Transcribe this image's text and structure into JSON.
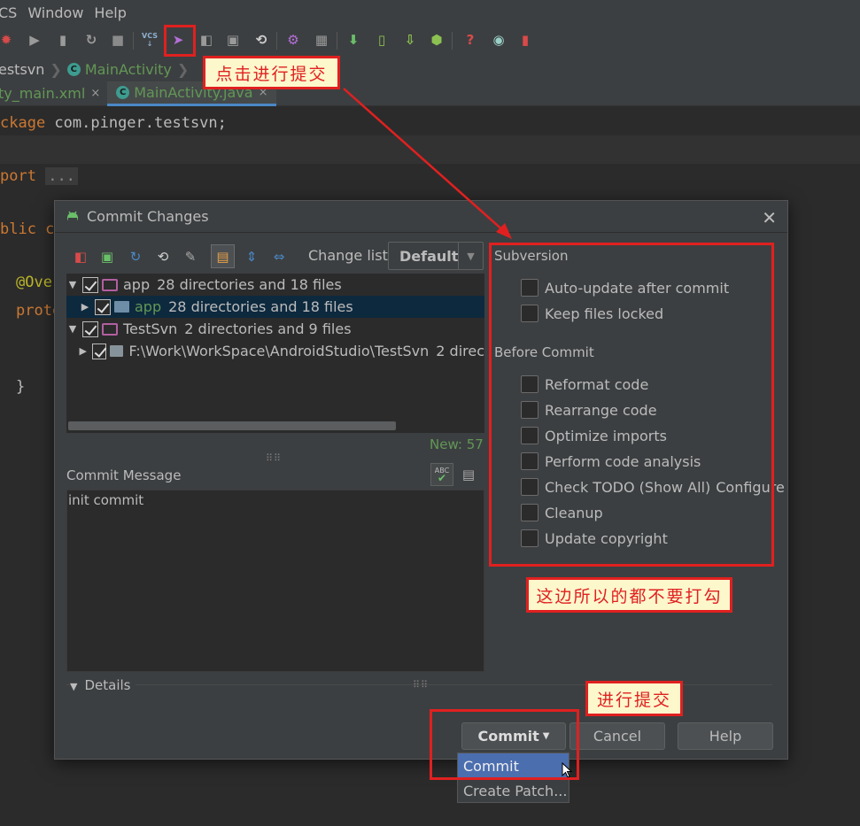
{
  "menubar": {
    "items": [
      "CS",
      "Window",
      "Help"
    ]
  },
  "breadcrumb": {
    "project": "estsvn",
    "class": "MainActivity"
  },
  "tabs": [
    {
      "label": "ty_main.xml",
      "close": "×"
    },
    {
      "label": "MainActivity.java",
      "close": "×"
    }
  ],
  "code": {
    "line1_kw": "ckage",
    "line1_rest": " com.pinger.testsvn;",
    "line2_kw": "port",
    "line2_fold": "...",
    "line3_kw": "blic c",
    "line4": "@Ove",
    "line5": "prote",
    "line6": "}"
  },
  "callouts": {
    "click_commit": "点击进行提交",
    "no_check": "这边所以的都不要打勾",
    "do_commit": "进行提交"
  },
  "dialog": {
    "title": "Commit Changes",
    "close": "✕",
    "changelist_label": "Change list:",
    "changelist_value": "Default",
    "tree": [
      {
        "name": "app",
        "info": "28 directories and 18 files"
      },
      {
        "name": "app",
        "info": "28 directories and 18 files"
      },
      {
        "name": "TestSvn",
        "info": "2 directories and 9 files"
      },
      {
        "name": "F:\\Work\\WorkSpace\\AndroidStudio\\TestSvn",
        "info": "2 direc"
      }
    ],
    "new_count": "New: 57",
    "commit_message_label": "Commit Message",
    "commit_message": "init commit",
    "spell_icon_text": "ABC",
    "subversion": {
      "title": "Subversion",
      "options": [
        "Auto-update after commit",
        "Keep files locked"
      ]
    },
    "before_commit": {
      "title": "Before Commit",
      "options": [
        "Reformat code",
        "Rearrange code",
        "Optimize imports",
        "Perform code analysis",
        "Check TODO (Show All)",
        "Cleanup",
        "Update copyright"
      ],
      "configure": "Configure"
    },
    "details": "Details",
    "buttons": {
      "commit": "Commit",
      "cancel": "Cancel",
      "help": "Help"
    },
    "commit_menu": [
      "Commit",
      "Create Patch..."
    ]
  },
  "colors": {
    "accent": "#4b6eaf",
    "annotation_red": "#e02020",
    "callout_bg": "#fdf7cc",
    "green": "#629755"
  }
}
